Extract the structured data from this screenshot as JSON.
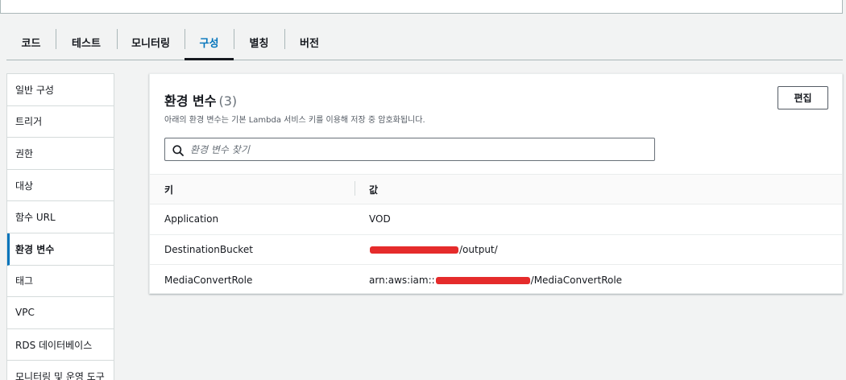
{
  "tabs": [
    {
      "label": "코드"
    },
    {
      "label": "테스트"
    },
    {
      "label": "모니터링"
    },
    {
      "label": "구성",
      "active": true
    },
    {
      "label": "별칭"
    },
    {
      "label": "버전"
    }
  ],
  "sidebar": {
    "items": [
      {
        "label": "일반 구성"
      },
      {
        "label": "트리거"
      },
      {
        "label": "권한"
      },
      {
        "label": "대상"
      },
      {
        "label": "함수 URL"
      },
      {
        "label": "환경 변수",
        "active": true
      },
      {
        "label": "태그"
      },
      {
        "label": "VPC"
      },
      {
        "label": "RDS 데이터베이스"
      },
      {
        "label": "모니터링 및 운영 도구"
      }
    ]
  },
  "env": {
    "title": "환경 변수",
    "count": "(3)",
    "description": "아래의 환경 변수는 기본 Lambda 서비스 키를 이용해 저장 중 암호화됩니다.",
    "edit_label": "편집",
    "search_placeholder": "환경 변수 찾기",
    "columns": {
      "key": "키",
      "value": "값"
    },
    "rows": [
      {
        "key": "Application",
        "value_prefix": "",
        "value_suffix": "VOD"
      },
      {
        "key": "DestinationBucket",
        "value_prefix": "",
        "value_suffix": "/output/"
      },
      {
        "key": "MediaConvertRole",
        "value_prefix": "arn:aws:iam::",
        "value_suffix": "/MediaConvertRole"
      }
    ]
  },
  "colors": {
    "accent": "#0073bb",
    "redaction": "#e52b2b"
  }
}
